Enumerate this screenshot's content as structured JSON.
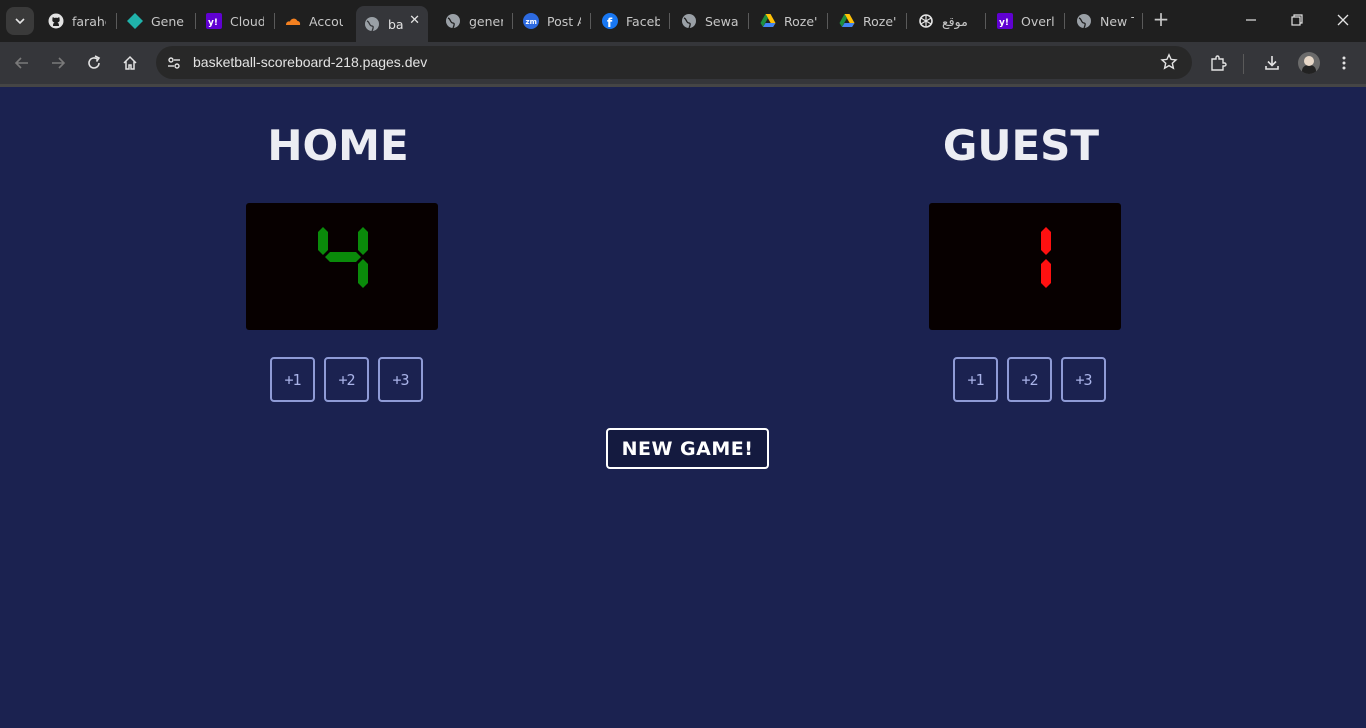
{
  "browser": {
    "tabs": [
      {
        "title": "farahe",
        "icon": "github-icon"
      },
      {
        "title": "Gener",
        "icon": "diamond-icon"
      },
      {
        "title": "Cloud",
        "icon": "yahoo-icon"
      },
      {
        "title": "Accou",
        "icon": "cloudflare-icon"
      },
      {
        "title": "ba",
        "icon": "globe-icon",
        "active": true
      },
      {
        "title": "gener",
        "icon": "globe-icon"
      },
      {
        "title": "Post A",
        "icon": "zm-icon"
      },
      {
        "title": "Faceb",
        "icon": "facebook-icon"
      },
      {
        "title": "Sewar",
        "icon": "globe-icon"
      },
      {
        "title": "Roze'",
        "icon": "drive-icon"
      },
      {
        "title": "Roze'",
        "icon": "drive-icon"
      },
      {
        "title": "موقع",
        "icon": "openai-icon"
      },
      {
        "title": "Overle",
        "icon": "yahoo-icon"
      },
      {
        "title": "New T",
        "icon": "globe-icon"
      }
    ],
    "url": "basketball-scoreboard-218.pages.dev"
  },
  "scoreboard": {
    "home": {
      "title": "HOME",
      "score": 4,
      "score_color": "#0a8a0a",
      "buttons": [
        "+1",
        "+2",
        "+3"
      ]
    },
    "guest": {
      "title": "GUEST",
      "score": 1,
      "score_color": "#ff1010",
      "buttons": [
        "+1",
        "+2",
        "+3"
      ]
    },
    "new_game_label": "NEW GAME!"
  },
  "colors": {
    "page_background": "#1b2250",
    "score_background": "#070000",
    "button_border": "#8f9bd6"
  }
}
